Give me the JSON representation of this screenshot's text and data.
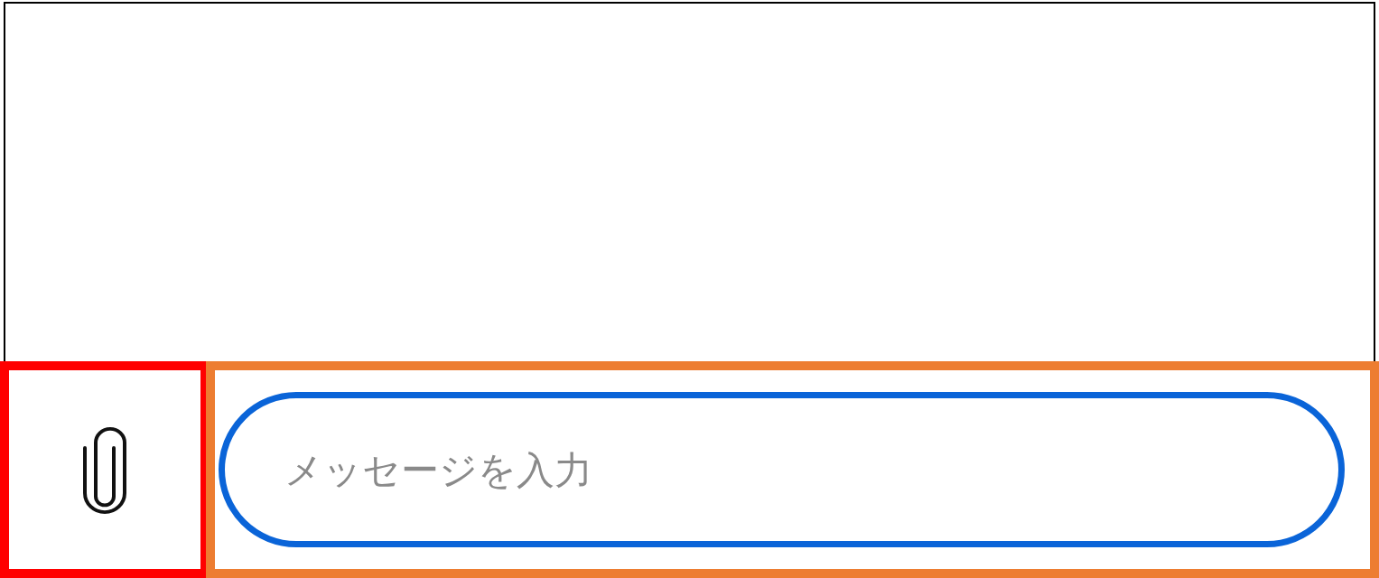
{
  "message_input": {
    "placeholder": "メッセージを入力"
  }
}
